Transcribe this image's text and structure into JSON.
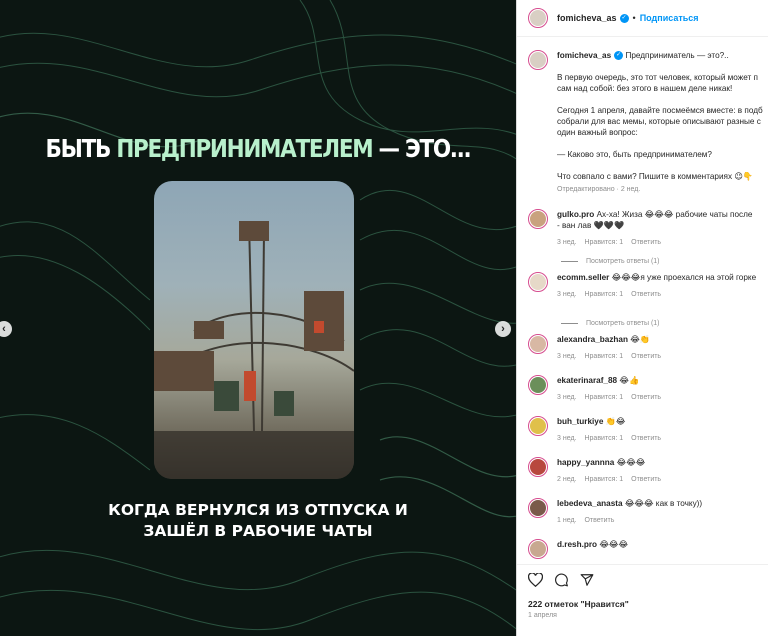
{
  "media": {
    "headline_part1": "БЫТЬ",
    "headline_accent": "ПРЕДПРИНИМАТЕЛЕМ",
    "headline_part2": "— ЭТО...",
    "caption_line1": "КОГДА ВЕРНУЛСЯ ИЗ ОТПУСКА И",
    "caption_line2": "ЗАШЁЛ В РАБОЧИЕ ЧАТЫ",
    "prev_icon": "‹",
    "next_icon": "›"
  },
  "header": {
    "username": "fomicheva_as",
    "dot": "•",
    "follow": "Подписаться"
  },
  "post": {
    "username": "fomicheva_as",
    "title": "Предприниматель — это?..",
    "para1_line1": "В первую очередь, это тот человек, который может п",
    "para1_line2": "сам над собой: без этого в нашем деле никак!",
    "para2_line1": "Сегодня 1 апреля, давайте посмеёмся вместе: в подб",
    "para2_line2": "собрали для вас мемы, которые описывают разные с",
    "para2_line3": "один важный вопрос:",
    "para3": "— Каково это, быть предпринимателем?",
    "para4": "Что совпало с вами? Пишите в комментариях 😉👇",
    "edited": "Отредактировано · 2 нед."
  },
  "comments": [
    {
      "user": "gulko.pro",
      "text": "Ах-ха! Жиза 😂😂😂 рабочие чаты после",
      "text2": "- ван лав 🖤🖤🖤",
      "time": "3 нед.",
      "likes": "Нравится: 1",
      "reply": "Ответить",
      "replies": "Посмотреть ответы (1)",
      "avatar_color": "#c9a27e"
    },
    {
      "user": "ecomm.seller",
      "text": "😂😂😂я уже проехался на этой горке",
      "time": "3 нед.",
      "likes": "Нравится: 1",
      "reply": "Ответить",
      "replies": "Посмотреть ответы (1)",
      "avatar_color": "#e6d9c8"
    },
    {
      "user": "alexandra_bazhan",
      "text": "😂👏",
      "time": "3 нед.",
      "likes": "Нравится: 1",
      "reply": "Ответить",
      "avatar_color": "#d8b8a4"
    },
    {
      "user": "ekaterinaraf_88",
      "text": "😂👍",
      "time": "3 нед.",
      "likes": "Нравится: 1",
      "reply": "Ответить",
      "avatar_color": "#6b8f5a"
    },
    {
      "user": "buh_turkiye",
      "text": "👏😂",
      "time": "3 нед.",
      "likes": "Нравится: 1",
      "reply": "Ответить",
      "avatar_color": "#e0c04a"
    },
    {
      "user": "happy_yannna",
      "text": "😂😂😂",
      "time": "2 нед.",
      "likes": "Нравится: 1",
      "reply": "Ответить",
      "avatar_color": "#b8483e"
    },
    {
      "user": "lebedeva_anasta",
      "text": "😂😂😂 как в точку))",
      "time": "1 нед.",
      "likes": "",
      "reply": "Ответить",
      "avatar_color": "#7a5a4a"
    },
    {
      "user": "d.resh.pro",
      "text": "😂😂😂",
      "time": "",
      "likes": "",
      "reply": "",
      "avatar_color": "#c8a890"
    }
  ],
  "footer": {
    "likes": "222 отметок \"Нравится\"",
    "date": "1 апреля"
  },
  "colors": {
    "accent": "#0095f6",
    "headline_accent": "#b8f0cc",
    "media_bg": "#0c1612"
  },
  "icons": [
    "heart-icon",
    "comment-icon",
    "share-icon"
  ]
}
